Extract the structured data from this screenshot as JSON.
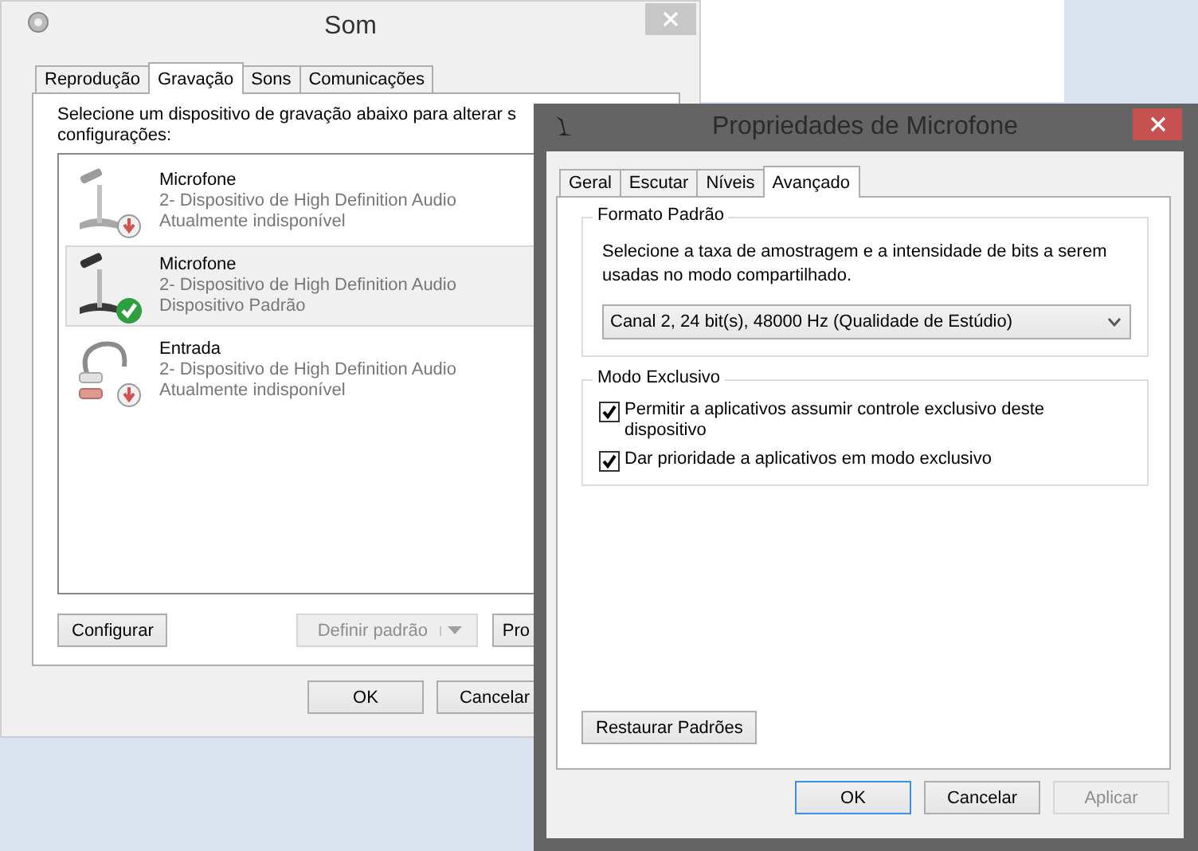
{
  "sound_window": {
    "title": "Som",
    "tabs": [
      {
        "label": "Reprodução",
        "selected": false
      },
      {
        "label": "Gravação",
        "selected": true
      },
      {
        "label": "Sons",
        "selected": false
      },
      {
        "label": "Comunicações",
        "selected": false
      }
    ],
    "instruction_lines": [
      "Selecione um dispositivo de gravação abaixo para alterar s",
      "configurações:"
    ],
    "devices": [
      {
        "kind": "microphone",
        "name": "Microfone",
        "driver": "2- Dispositivo de High Definition Audio",
        "status": "Atualmente indisponível",
        "available": false,
        "default": false,
        "selected": false
      },
      {
        "kind": "microphone",
        "name": "Microfone",
        "driver": "2- Dispositivo de High Definition Audio",
        "status": "Dispositivo Padrão",
        "available": true,
        "default": true,
        "selected": true
      },
      {
        "kind": "line_in",
        "name": "Entrada",
        "driver": "2- Dispositivo de High Definition Audio",
        "status": "Atualmente indisponível",
        "available": false,
        "default": false,
        "selected": false
      }
    ],
    "configure_button": {
      "label": "Configurar",
      "disabled": false
    },
    "set_default_button": {
      "label": "Definir padrão",
      "disabled": true
    },
    "properties_button": {
      "label": "Pro",
      "disabled": false
    },
    "footer_buttons": [
      {
        "label": "OK",
        "disabled": false,
        "default": false
      },
      {
        "label": "Cancelar",
        "disabled": false,
        "default": false
      }
    ]
  },
  "properties_window": {
    "title": "Propriedades de Microfone",
    "tabs": [
      {
        "label": "Geral",
        "selected": false
      },
      {
        "label": "Escutar",
        "selected": false
      },
      {
        "label": "Níveis",
        "selected": false
      },
      {
        "label": "Avançado",
        "selected": true
      }
    ],
    "default_format": {
      "heading": "Formato Padrão",
      "description": "Selecione a taxa de amostragem e a intensidade de bits a serem usadas no modo compartilhado.",
      "value": "Canal 2, 24 bit(s), 48000 Hz (Qualidade de Estúdio)"
    },
    "exclusive_mode": {
      "heading": "Modo Exclusivo",
      "options": [
        {
          "label": "Permitir a aplicativos assumir controle exclusivo deste dispositivo",
          "checked": true
        },
        {
          "label": "Dar prioridade a aplicativos em modo exclusivo",
          "checked": true
        }
      ]
    },
    "restore_button": {
      "label": "Restaurar Padrões",
      "disabled": false
    },
    "footer_buttons": [
      {
        "label": "OK",
        "disabled": false,
        "default": true
      },
      {
        "label": "Cancelar",
        "disabled": false,
        "default": false
      },
      {
        "label": "Aplicar",
        "disabled": true,
        "default": false
      }
    ]
  }
}
